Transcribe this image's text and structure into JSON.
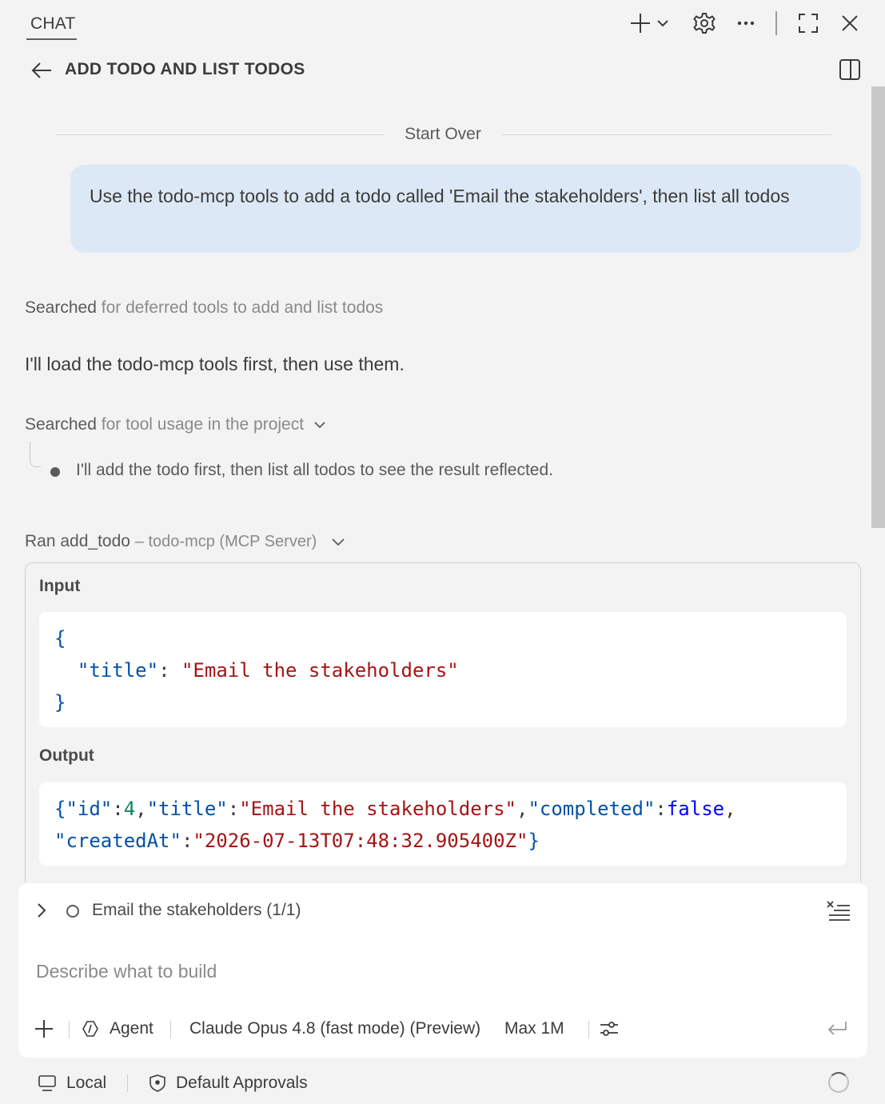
{
  "header": {
    "tab_label": "CHAT",
    "icons": [
      "plus-icon",
      "chevron-down-icon",
      "gear-icon",
      "more-icon",
      "maximize-icon",
      "close-icon"
    ]
  },
  "title_bar": {
    "title": "ADD TODO AND LIST TODOS"
  },
  "conversation": {
    "start_over": "Start Over",
    "user_message": "Use the todo-mcp tools to add a todo called 'Email the stakeholders', then list all todos",
    "search_1": {
      "verb": "Searched",
      "detail": "for deferred tools to add and list todos"
    },
    "assistant_message": "I'll load the todo-mcp tools first, then use them.",
    "search_2": {
      "verb": "Searched",
      "detail": "for tool usage in the project"
    },
    "thinking_bullet": "I'll add the todo first, then list all todos to see the result reflected.",
    "tool_run": {
      "verb": "Ran add_todo",
      "server": "– todo-mcp (MCP Server)",
      "input_label": "Input",
      "output_label": "Output",
      "input_key": "\"title\"",
      "input_value": "\"Email the stakeholders\"",
      "output": {
        "id_key": "\"id\"",
        "id_value": "4",
        "title_key": "\"title\"",
        "title_value": "\"Email the stakeholders\"",
        "completed_key": "\"completed\"",
        "completed_value": "false",
        "created_key": "\"createdAt\"",
        "created_value": "\"2026-07-13T07:48:32.905400Z\""
      }
    }
  },
  "input_panel": {
    "todo_summary": "Email the stakeholders (1/1)",
    "placeholder": "Describe what to build",
    "mode": "Agent",
    "model": "Claude Opus 4.8 (fast mode) (Preview)",
    "context": "Max 1M"
  },
  "status_bar": {
    "location": "Local",
    "approvals": "Default Approvals"
  },
  "colors": {
    "background": "#f3f3f3",
    "user_bubble": "#dce8f5",
    "json_key": "#0451a5",
    "json_string": "#a31515",
    "json_number": "#098658",
    "json_keyword": "#0000ff"
  }
}
